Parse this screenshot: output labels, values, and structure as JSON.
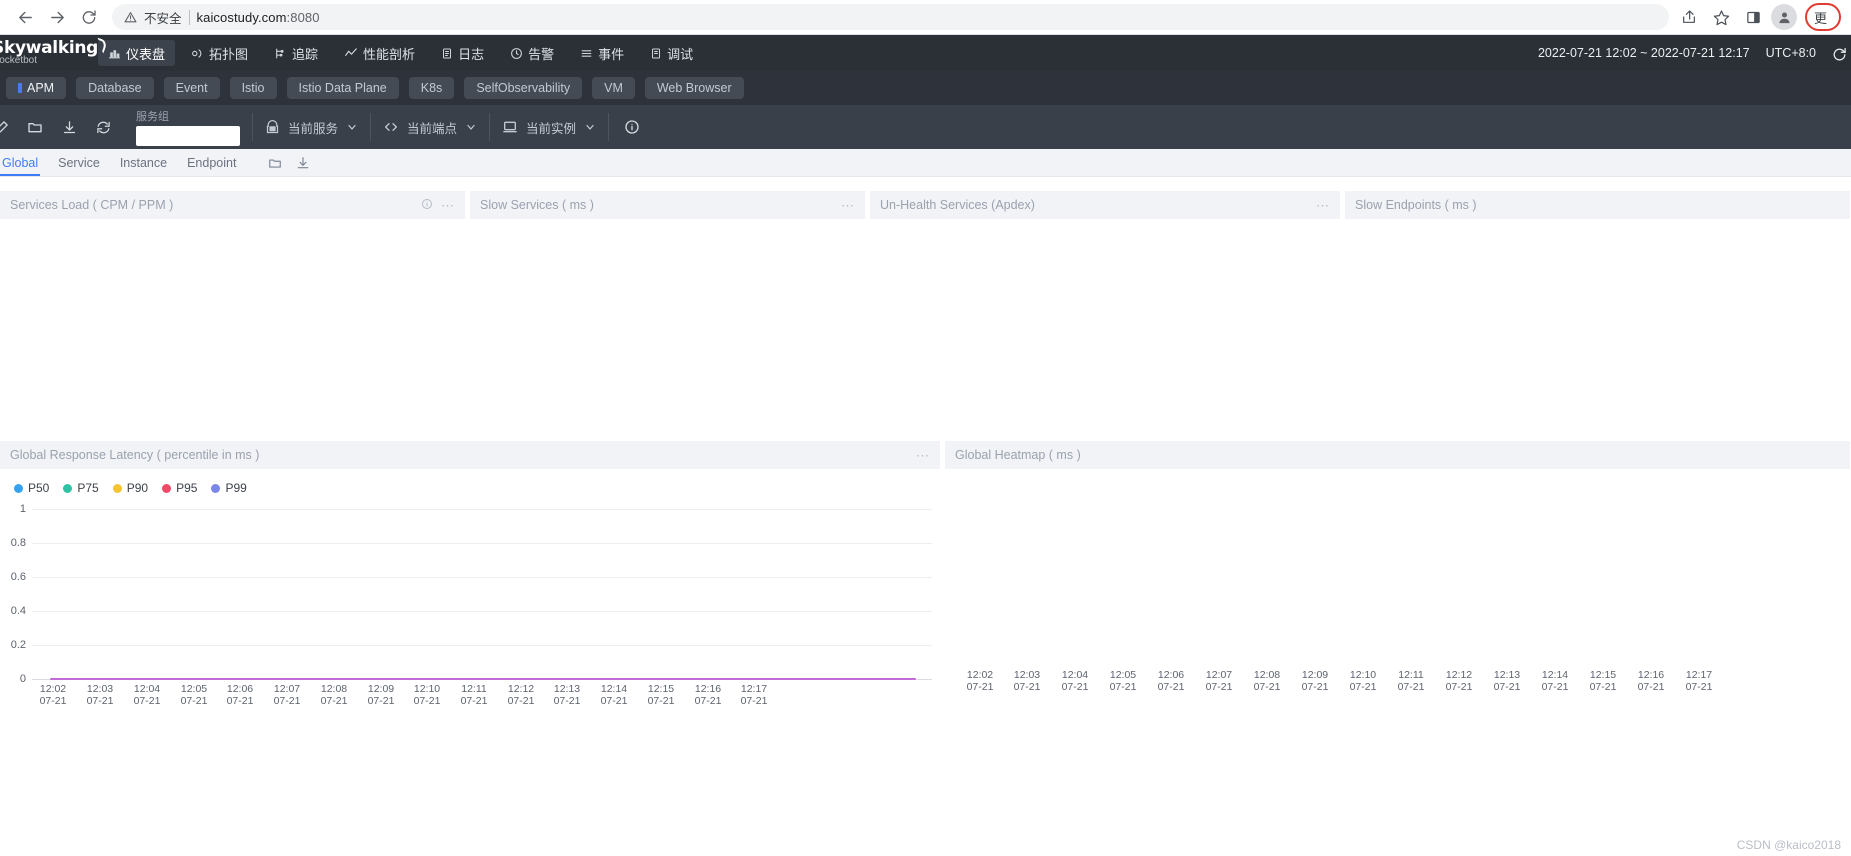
{
  "browser": {
    "back_icon": "back-arrow-icon",
    "forward_icon": "forward-arrow-icon",
    "reload_icon": "reload-icon",
    "security_warning": "不安全",
    "url": "kaicostudy.com:8080",
    "url_host": "kaicostudy.com",
    "url_port": ":8080",
    "share_icon": "share-icon",
    "bookmark_icon": "star-icon",
    "sidepanel_icon": "side-panel-icon",
    "profile_icon": "profile-avatar-icon",
    "more_label": "更"
  },
  "header": {
    "logo_line1": "Skywalking",
    "logo_line2": "Rocketbot",
    "nav": [
      {
        "label": "仪表盘",
        "icon": "dashboard-icon",
        "active": true
      },
      {
        "label": "拓扑图",
        "icon": "topology-icon",
        "active": false
      },
      {
        "label": "追踪",
        "icon": "trace-icon",
        "active": false
      },
      {
        "label": "性能剖析",
        "icon": "profile-icon",
        "active": false
      },
      {
        "label": "日志",
        "icon": "log-icon",
        "active": false
      },
      {
        "label": "告警",
        "icon": "alarm-icon",
        "active": false
      },
      {
        "label": "事件",
        "icon": "event-icon",
        "active": false
      },
      {
        "label": "调试",
        "icon": "debug-icon",
        "active": false
      }
    ],
    "time_range": "2022-07-21 12:02 ~ 2022-07-21 12:17",
    "timezone": "UTC+8:0",
    "reload_icon": "refresh-icon"
  },
  "tabs": [
    {
      "label": "APM",
      "active": true
    },
    {
      "label": "Database",
      "active": false
    },
    {
      "label": "Event",
      "active": false
    },
    {
      "label": "Istio",
      "active": false
    },
    {
      "label": "Istio Data Plane",
      "active": false
    },
    {
      "label": "K8s",
      "active": false
    },
    {
      "label": "SelfObservability",
      "active": false
    },
    {
      "label": "VM",
      "active": false
    },
    {
      "label": "Web Browser",
      "active": false
    }
  ],
  "toolbar": {
    "icons": [
      {
        "name": "edit-icon"
      },
      {
        "name": "folder-icon"
      },
      {
        "name": "download-icon"
      },
      {
        "name": "refresh-icon"
      }
    ],
    "service_group_label": "服务组",
    "service_group_value": "",
    "selectors": [
      {
        "label": "当前服务",
        "icon": "service-icon"
      },
      {
        "label": "当前端点",
        "icon": "endpoint-icon"
      },
      {
        "label": "当前实例",
        "icon": "instance-icon"
      }
    ],
    "info_icon": "info-icon"
  },
  "subtabs": {
    "items": [
      {
        "label": "Global",
        "active": true
      },
      {
        "label": "Service",
        "active": false
      },
      {
        "label": "Instance",
        "active": false
      },
      {
        "label": "Endpoint",
        "active": false
      }
    ],
    "icons": [
      {
        "name": "folder-icon"
      },
      {
        "name": "download-icon"
      }
    ]
  },
  "cards_row1": [
    {
      "title": "Services Load ( CPM / PPM )",
      "has_info": true,
      "menu": "⋯"
    },
    {
      "title": "Slow Services ( ms )",
      "has_info": false,
      "menu": "⋯"
    },
    {
      "title": "Un-Health Services (Apdex)",
      "has_info": false,
      "menu": "⋯"
    },
    {
      "title": "Slow Endpoints ( ms )",
      "has_info": false,
      "menu": ""
    }
  ],
  "cards_row2": [
    {
      "title": "Global Response Latency ( percentile in ms )",
      "menu": "⋯"
    },
    {
      "title": "Global Heatmap ( ms )",
      "menu": ""
    }
  ],
  "chart_data": {
    "type": "line",
    "title": "Global Response Latency ( percentile in ms )",
    "xlabel": "",
    "ylabel": "",
    "ylim": [
      0,
      1
    ],
    "yticks": [
      "0",
      "0.2",
      "0.4",
      "0.6",
      "0.8",
      "1"
    ],
    "grid": true,
    "legend_position": "top-left",
    "categories": [
      "12:02\n07-21",
      "12:03\n07-21",
      "12:04\n07-21",
      "12:05\n07-21",
      "12:06\n07-21",
      "12:07\n07-21",
      "12:08\n07-21",
      "12:09\n07-21",
      "12:10\n07-21",
      "12:11\n07-21",
      "12:12\n07-21",
      "12:13\n07-21",
      "12:14\n07-21",
      "12:15\n07-21",
      "12:16\n07-21",
      "12:17\n07-21"
    ],
    "xtick_times": [
      "12:02",
      "12:03",
      "12:04",
      "12:05",
      "12:06",
      "12:07",
      "12:08",
      "12:09",
      "12:10",
      "12:11",
      "12:12",
      "12:13",
      "12:14",
      "12:15",
      "12:16",
      "12:17"
    ],
    "xtick_dates": [
      "07-21",
      "07-21",
      "07-21",
      "07-21",
      "07-21",
      "07-21",
      "07-21",
      "07-21",
      "07-21",
      "07-21",
      "07-21",
      "07-21",
      "07-21",
      "07-21",
      "07-21",
      "07-21"
    ],
    "series": [
      {
        "name": "P50",
        "color": "#35a3f0",
        "values": [
          0,
          0,
          0,
          0,
          0,
          0,
          0,
          0,
          0,
          0,
          0,
          0,
          0,
          0,
          0,
          0
        ]
      },
      {
        "name": "P75",
        "color": "#2fc3a5",
        "values": [
          0,
          0,
          0,
          0,
          0,
          0,
          0,
          0,
          0,
          0,
          0,
          0,
          0,
          0,
          0,
          0
        ]
      },
      {
        "name": "P90",
        "color": "#f5c431",
        "values": [
          0,
          0,
          0,
          0,
          0,
          0,
          0,
          0,
          0,
          0,
          0,
          0,
          0,
          0,
          0,
          0
        ]
      },
      {
        "name": "P95",
        "color": "#f0496a",
        "values": [
          0,
          0,
          0,
          0,
          0,
          0,
          0,
          0,
          0,
          0,
          0,
          0,
          0,
          0,
          0,
          0
        ]
      },
      {
        "name": "P99",
        "color": "#7b87e8",
        "values": [
          0,
          0,
          0,
          0,
          0,
          0,
          0,
          0,
          0,
          0,
          0,
          0,
          0,
          0,
          0,
          0
        ]
      }
    ]
  },
  "heatmap_axis": {
    "xtick_times": [
      "12:02",
      "12:03",
      "12:04",
      "12:05",
      "12:06",
      "12:07",
      "12:08",
      "12:09",
      "12:10",
      "12:11",
      "12:12",
      "12:13",
      "12:14",
      "12:15",
      "12:16",
      "12:17"
    ],
    "xtick_dates": [
      "07-21",
      "07-21",
      "07-21",
      "07-21",
      "07-21",
      "07-21",
      "07-21",
      "07-21",
      "07-21",
      "07-21",
      "07-21",
      "07-21",
      "07-21",
      "07-21",
      "07-21",
      "07-21"
    ]
  },
  "watermark": "CSDN @kaico2018",
  "colors": {
    "accent": "#3f7df6",
    "header_bg": "#2b3037",
    "toolbar_bg": "#3a4049",
    "card_head_bg": "#f2f3f7",
    "latency_line": "#c06bd8"
  }
}
